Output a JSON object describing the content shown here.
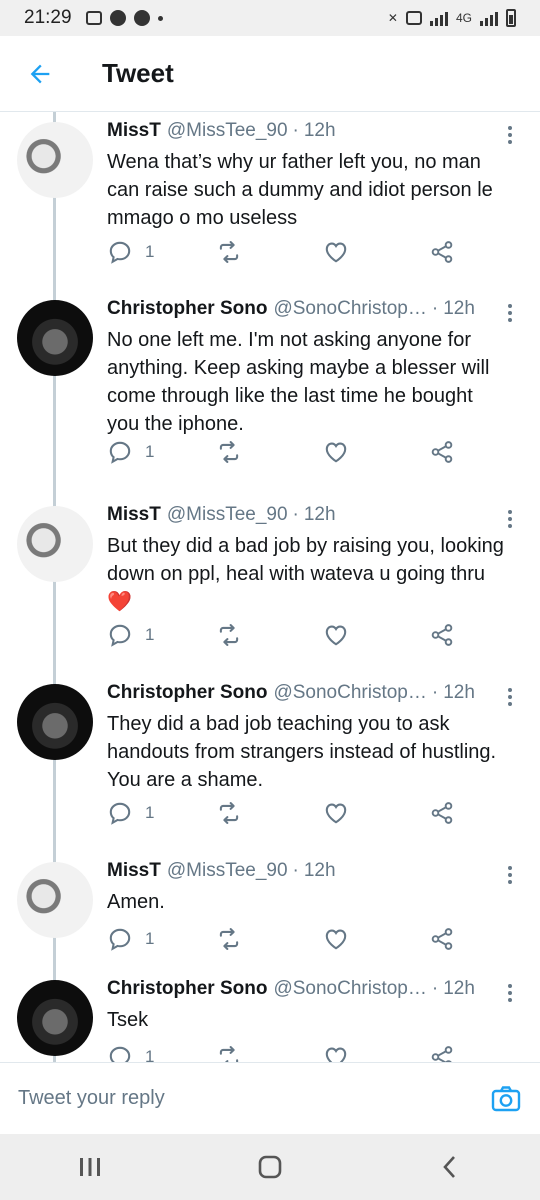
{
  "status_bar": {
    "time": "21:29",
    "network_label": "4G"
  },
  "header": {
    "title": "Tweet"
  },
  "tweets": [
    {
      "author": "MissT",
      "handle": "@MissTee_90",
      "time": "12h",
      "text": "Wena that’s why ur father left you, no man can raise such a dummy and idiot person le mmago o mo useless",
      "reply_count": "1",
      "avatar": "misst"
    },
    {
      "author": "Christopher Sono",
      "handle": "@SonoChristop…",
      "time": "12h",
      "text": "No one left me. I'm not asking anyone for anything. Keep asking maybe a blesser will come through like the last time he bought you the iphone.",
      "reply_count": "1",
      "avatar": "sono"
    },
    {
      "author": "MissT",
      "handle": "@MissTee_90",
      "time": "12h",
      "text": "But they did a bad job by raising you, looking down on ppl, heal with wateva u going thru",
      "emoji": "❤️",
      "reply_count": "1",
      "avatar": "misst"
    },
    {
      "author": "Christopher Sono",
      "handle": "@SonoChristop…",
      "time": "12h",
      "text": "They did a bad job teaching you to ask handouts from strangers instead of hustling. You are a shame.",
      "reply_count": "1",
      "avatar": "sono"
    },
    {
      "author": "MissT",
      "handle": "@MissTee_90",
      "time": "12h",
      "text": "Amen.",
      "reply_count": "1",
      "avatar": "misst"
    },
    {
      "author": "Christopher Sono",
      "handle": "@SonoChristop…",
      "time": "12h",
      "text": "Tsek",
      "reply_count": "1",
      "avatar": "sono"
    }
  ],
  "reply_bar": {
    "placeholder": "Tweet your reply"
  },
  "colors": {
    "accent": "#1da1f2",
    "secondary_text": "#657786",
    "heart_emoji": "#e0245e"
  },
  "icons": {
    "back": "arrow-left-icon",
    "reply": "reply-icon",
    "retweet": "retweet-icon",
    "like": "heart-icon",
    "share": "share-icon",
    "more": "more-vertical-icon",
    "camera": "camera-icon"
  }
}
